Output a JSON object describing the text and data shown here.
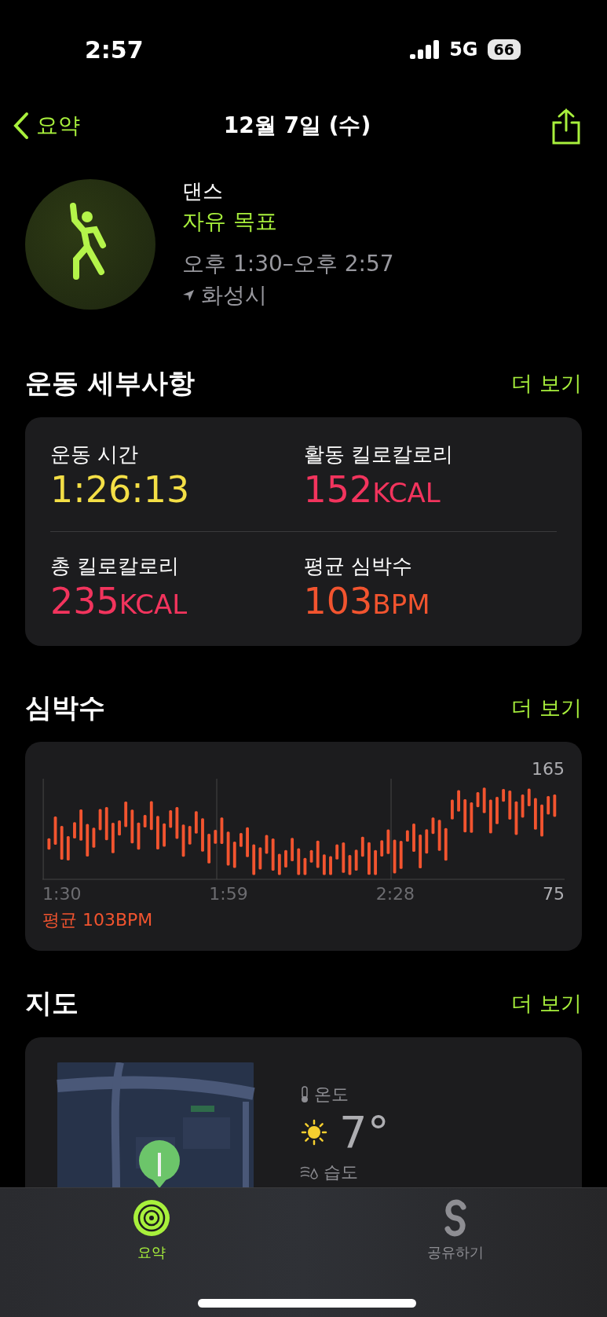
{
  "status_bar": {
    "time": "2:57",
    "network": "5G",
    "battery": "66"
  },
  "nav": {
    "back": "요약",
    "title": "12월 7일 (수)"
  },
  "workout": {
    "name": "댄스",
    "goal": "자유 목표",
    "time_range": "오후 1:30–오후 2:57",
    "location": "화성시"
  },
  "details": {
    "title": "운동 세부사항",
    "more": "더 보기",
    "metrics": [
      {
        "label": "운동 시간",
        "value": "1:26:13",
        "color": "#f4df46"
      },
      {
        "label": "활동 킬로칼로리",
        "value": "152",
        "unit": "KCAL",
        "color": "#f2345d"
      },
      {
        "label": "총 킬로칼로리",
        "value": "235",
        "unit": "KCAL",
        "color": "#f2345d"
      },
      {
        "label": "평균 심박수",
        "value": "103",
        "unit": "BPM",
        "color": "#f2542f"
      }
    ]
  },
  "heart_rate": {
    "title": "심박수",
    "more": "더 보기",
    "y_max": "165",
    "y_min": "75",
    "x_labels": [
      "1:30",
      "1:59",
      "2:28"
    ],
    "average": "평균 103BPM"
  },
  "map": {
    "title": "지도",
    "more": "더 보기",
    "temperature_label": "온도",
    "temperature": "7°",
    "humidity_label": "습도"
  },
  "tabs": [
    {
      "label": "요약",
      "selected": true
    },
    {
      "label": "공유하기",
      "selected": false
    }
  ]
}
